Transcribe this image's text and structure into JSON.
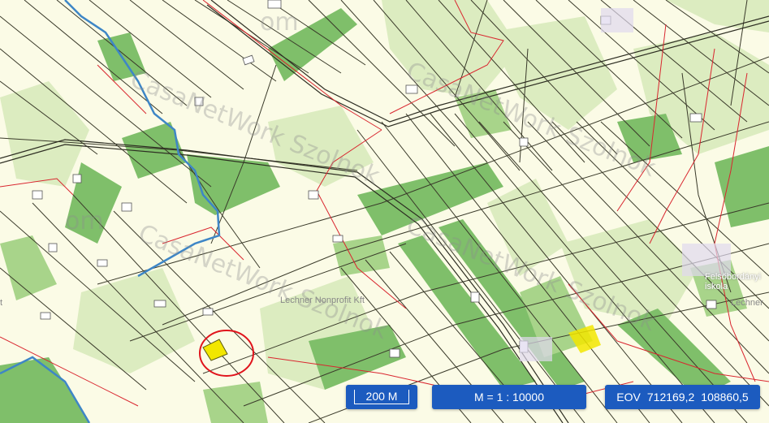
{
  "map": {
    "watermark": "CasaNetWork Szolnok",
    "watermark_short": "om",
    "credit": "Lechner Nonprofit Kft",
    "school_label_1": "Felsőbordányi",
    "school_label_2": "iskola",
    "left_edge_label": "t",
    "right_edge_label": "Lechner",
    "highlight_color": "#f2e600",
    "circle_color": "#e0141c",
    "road_color": "#d9262f",
    "canal_color": "#3e86c6"
  },
  "controls": {
    "scale_label": "200 M",
    "ratio_label": "M = 1 : 10000",
    "eov_label": "EOV",
    "eov_x": "712169,2",
    "eov_y": "108860,5"
  }
}
